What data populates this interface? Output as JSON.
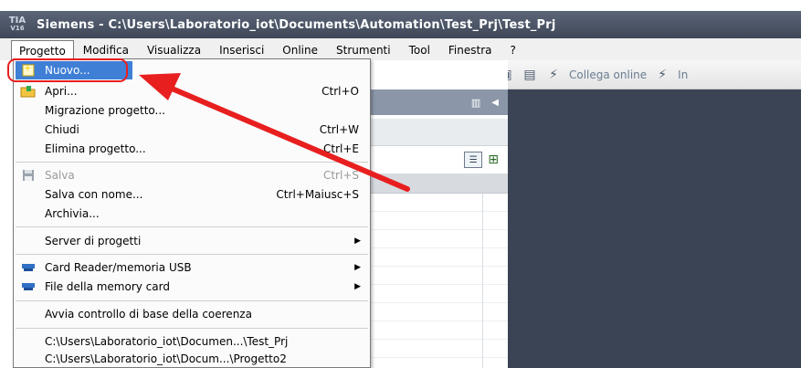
{
  "window": {
    "app_badge_top": "TIA",
    "app_badge_bottom": "V16",
    "title": "Siemens - C:\\Users\\Laboratorio_iot\\Documents\\Automation\\Test_Prj\\Test_Prj"
  },
  "menubar": {
    "items": [
      "Progetto",
      "Modifica",
      "Visualizza",
      "Inserisci",
      "Online",
      "Strumenti",
      "Tool",
      "Finestra",
      "?"
    ]
  },
  "toolbar": {
    "go_online_label": "Collega online",
    "truncated_label": "In"
  },
  "dropdown": {
    "items": [
      {
        "label": "Nuovo...",
        "shortcut": ""
      },
      {
        "label": "Apri...",
        "shortcut": "Ctrl+O"
      },
      {
        "label": "Migrazione progetto...",
        "shortcut": ""
      },
      {
        "label": "Chiudi",
        "shortcut": "Ctrl+W"
      },
      {
        "label": "Elimina progetto...",
        "shortcut": "Ctrl+E"
      },
      {
        "label": "Salva",
        "shortcut": "Ctrl+S"
      },
      {
        "label": "Salva con nome...",
        "shortcut": "Ctrl+Maiusc+S"
      },
      {
        "label": "Archivia...",
        "shortcut": ""
      },
      {
        "label": "Server di progetti",
        "shortcut": ""
      },
      {
        "label": "Card Reader/memoria USB",
        "shortcut": ""
      },
      {
        "label": "File della memory card",
        "shortcut": ""
      },
      {
        "label": "Avvia controllo di base della coerenza",
        "shortcut": ""
      },
      {
        "label": "C:\\Users\\Laboratorio_iot\\Documen...\\Test_Prj",
        "shortcut": ""
      },
      {
        "label": "C:\\Users\\Laboratorio_iot\\Docum...\\Progetto2",
        "shortcut": ""
      }
    ]
  },
  "colors": {
    "highlight": "#3f7fd6",
    "annotation_red": "#e81f1f",
    "workspace": "#3b4455"
  }
}
